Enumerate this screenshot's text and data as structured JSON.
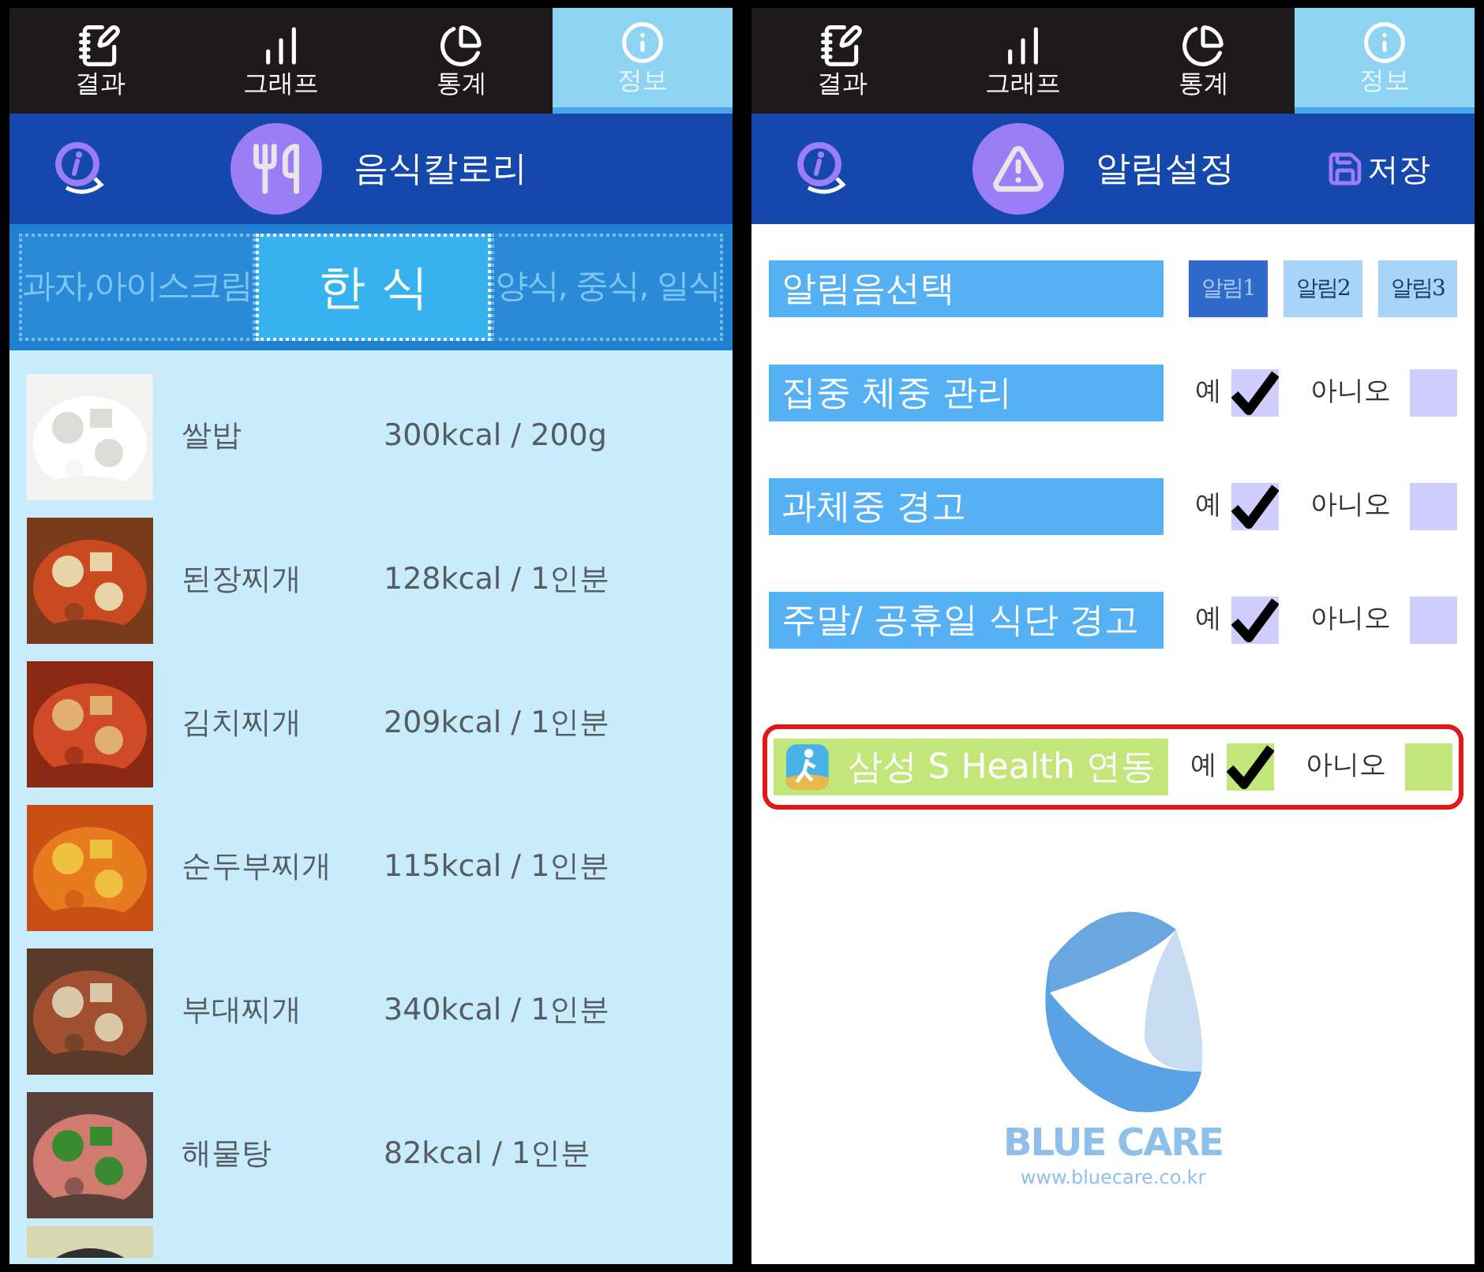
{
  "left_screen": {
    "tabs": [
      {
        "label": "결과",
        "selected": false
      },
      {
        "label": "그래프",
        "selected": false
      },
      {
        "label": "통계",
        "selected": false
      },
      {
        "label": "정보",
        "selected": true
      }
    ],
    "header": {
      "title": "음식칼로리"
    },
    "categories": [
      {
        "label": "과자,아이스크림",
        "selected": false
      },
      {
        "label": "한 식",
        "selected": true
      },
      {
        "label": "양식, 중식, 일식",
        "selected": false
      }
    ],
    "foods": [
      {
        "name": "쌀밥",
        "calories": "300kcal / 200g"
      },
      {
        "name": "된장찌개",
        "calories": "128kcal / 1인분"
      },
      {
        "name": "김치찌개",
        "calories": "209kcal / 1인분"
      },
      {
        "name": "순두부찌개",
        "calories": "115kcal / 1인분"
      },
      {
        "name": "부대찌개",
        "calories": "340kcal / 1인분"
      },
      {
        "name": "해물탕",
        "calories": "82kcal / 1인분"
      }
    ]
  },
  "right_screen": {
    "tabs": [
      {
        "label": "결과",
        "selected": false
      },
      {
        "label": "그래프",
        "selected": false
      },
      {
        "label": "통계",
        "selected": false
      },
      {
        "label": "정보",
        "selected": true
      }
    ],
    "header": {
      "title": "알림설정",
      "save_label": "저장"
    },
    "sound_row": {
      "label": "알림음선택",
      "options": [
        {
          "label": "알림1",
          "selected": true
        },
        {
          "label": "알림2",
          "selected": false
        },
        {
          "label": "알림3",
          "selected": false
        }
      ]
    },
    "settings": [
      {
        "kind": "alert",
        "label": "집중 체중 관리",
        "yes_label": "예",
        "yes_checked": true,
        "no_label": "아니오",
        "no_checked": false,
        "highlighted": false
      },
      {
        "kind": "alert",
        "label": "과체중 경고",
        "yes_label": "예",
        "yes_checked": true,
        "no_label": "아니오",
        "no_checked": false,
        "highlighted": false
      },
      {
        "kind": "alert",
        "label": "주말/ 공휴일 식단 경고",
        "yes_label": "예",
        "yes_checked": true,
        "no_label": "아니오",
        "no_checked": false,
        "highlighted": false
      },
      {
        "kind": "integration",
        "label": "삼성 S Health 연동",
        "yes_label": "예",
        "yes_checked": true,
        "no_label": "아니오",
        "no_checked": false,
        "highlighted": true
      }
    ],
    "logo": {
      "name": "BLUE CARE",
      "url": "www.bluecare.co.kr"
    }
  }
}
